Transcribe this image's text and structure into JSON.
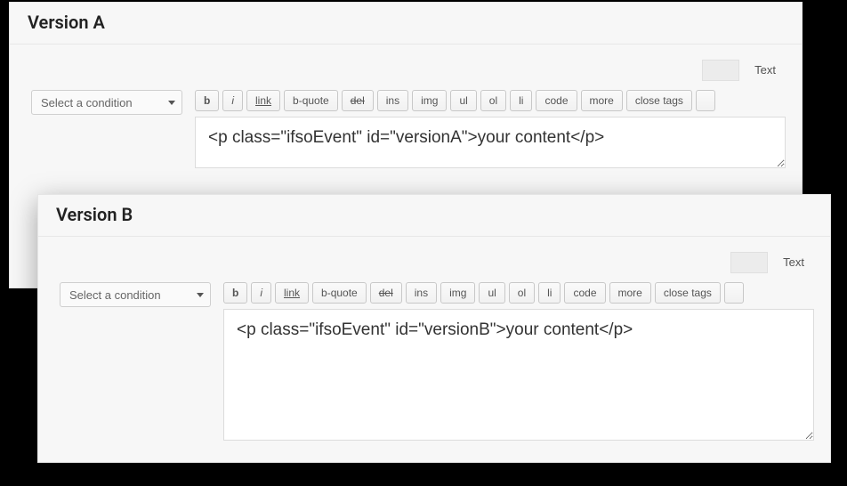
{
  "panels": [
    {
      "title": "Version A",
      "tab_text": "Text",
      "select_placeholder": "Select a condition",
      "toolbar": {
        "b": "b",
        "i": "i",
        "link": "link",
        "bquote": "b-quote",
        "del": "del",
        "ins": "ins",
        "img": "img",
        "ul": "ul",
        "ol": "ol",
        "li": "li",
        "code": "code",
        "more": "more",
        "close": "close tags"
      },
      "content": "<p class=\"ifsoEvent\" id=\"versionA\">your content</p>"
    },
    {
      "title": "Version B",
      "tab_text": "Text",
      "select_placeholder": "Select a condition",
      "toolbar": {
        "b": "b",
        "i": "i",
        "link": "link",
        "bquote": "b-quote",
        "del": "del",
        "ins": "ins",
        "img": "img",
        "ul": "ul",
        "ol": "ol",
        "li": "li",
        "code": "code",
        "more": "more",
        "close": "close tags"
      },
      "content": "<p class=\"ifsoEvent\" id=\"versionB\">your content</p>"
    }
  ]
}
